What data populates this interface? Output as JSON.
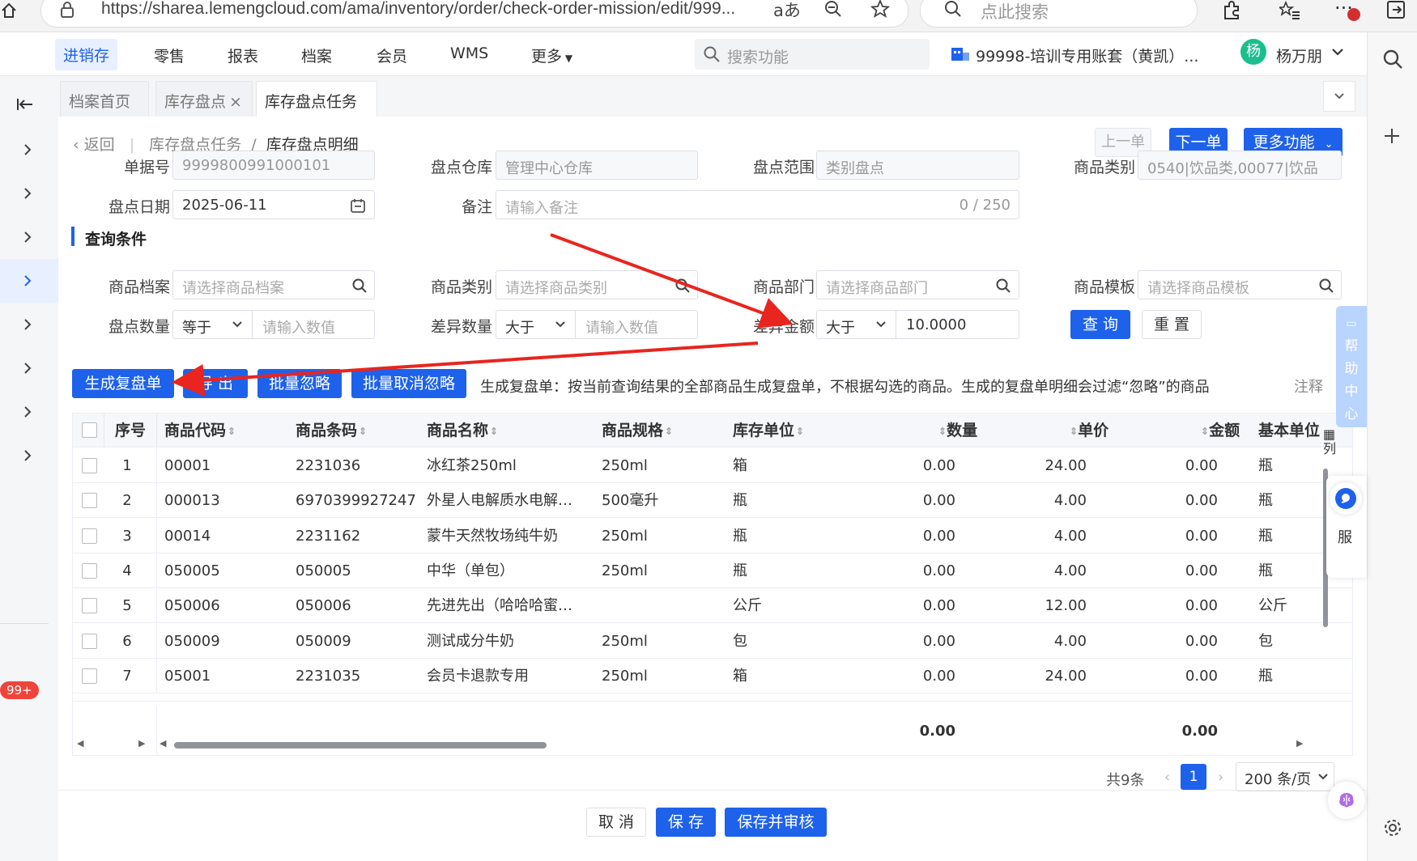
{
  "browser": {
    "url": "https://sharea.lemengcloud.com/ama/inventory/order/check-order-mission/edit/999...",
    "search_placeholder": "点此搜索",
    "reader_label": "aあ"
  },
  "nav": {
    "items": [
      "进销存",
      "零售",
      "报表",
      "档案",
      "会员",
      "WMS",
      "更多"
    ],
    "search_placeholder": "搜索功能",
    "account": "99998-培训专用账套（黄凯）...",
    "avatar_char": "杨",
    "user": "杨万朋"
  },
  "tabs": [
    {
      "label": "档案首页"
    },
    {
      "label": "库存盘点"
    },
    {
      "label": "库存盘点任务"
    }
  ],
  "breadcrumb": {
    "back": "返回",
    "parent": "库存盘点任务",
    "sep": "/",
    "current": "库存盘点明细"
  },
  "toolbar": {
    "prev": "上一单",
    "next": "下一单",
    "more": "更多功能"
  },
  "form": {
    "doc_no_label": "单据号",
    "doc_no": "9999800991000101",
    "warehouse_label": "盘点仓库",
    "warehouse": "管理中心仓库",
    "scope_label": "盘点范围",
    "scope": "类别盘点",
    "category_label": "商品类别",
    "category": "0540|饮品类,00077|饮品",
    "date_label": "盘点日期",
    "date": "2025-06-11",
    "remark_label": "备注",
    "remark_placeholder": "请输入备注",
    "remark_count": "0 / 250"
  },
  "query": {
    "section_title": "查询条件",
    "product_label": "商品档案",
    "product_ph": "请选择商品档案",
    "pcategory_label": "商品类别",
    "pcategory_ph": "请选择商品类别",
    "dept_label": "商品部门",
    "dept_ph": "请选择商品部门",
    "template_label": "商品模板",
    "template_ph": "请选择商品模板",
    "qty_label": "盘点数量",
    "qty_op": "等于",
    "qty_ph": "请输入数值",
    "diffqty_label": "差异数量",
    "diffqty_op": "大于",
    "diffqty_ph": "请输入数值",
    "diffamt_label": "差异金额",
    "diffamt_op": "大于",
    "diffamt_value": "10.0000",
    "search_btn": "查 询",
    "reset_btn": "重 置"
  },
  "actions": {
    "gen_recheck": "生成复盘单",
    "export": "导 出",
    "batch_ignore": "批量忽略",
    "batch_unignore": "批量取消忽略",
    "hint": "生成复盘单：按当前查询结果的全部商品生成复盘单，不根据勾选的商品。生成的复盘单明细会过滤“忽略”的商品",
    "note": "注释"
  },
  "table": {
    "headers": [
      "序号",
      "商品代码",
      "商品条码",
      "商品名称",
      "商品规格",
      "库存单位",
      "数量",
      "单价",
      "金额",
      "基本单位"
    ],
    "rows": [
      [
        "1",
        "00001",
        "2231036",
        "冰红茶250ml",
        "250ml",
        "箱",
        "0.00",
        "24.00",
        "0.00",
        "瓶"
      ],
      [
        "2",
        "000013",
        "6970399927247",
        "外星人电解质水电解…",
        "500毫升",
        "瓶",
        "0.00",
        "4.00",
        "0.00",
        "瓶"
      ],
      [
        "3",
        "00014",
        "2231162",
        "蒙牛天然牧场纯牛奶",
        "250ml",
        "瓶",
        "0.00",
        "4.00",
        "0.00",
        "瓶"
      ],
      [
        "4",
        "050005",
        "050005",
        "中华（单包）",
        "250ml",
        "瓶",
        "0.00",
        "4.00",
        "0.00",
        "瓶"
      ],
      [
        "5",
        "050006",
        "050006",
        "先进先出（哈哈哈蜜…",
        "",
        "公斤",
        "0.00",
        "12.00",
        "0.00",
        "公斤"
      ],
      [
        "6",
        "050009",
        "050009",
        "测试成分牛奶",
        "250ml",
        "包",
        "0.00",
        "4.00",
        "0.00",
        "包"
      ],
      [
        "7",
        "05001",
        "2231035",
        "会员卡退款专用",
        "250ml",
        "箱",
        "0.00",
        "24.00",
        "0.00",
        "瓶"
      ]
    ],
    "total_qty": "0.00",
    "total_amount": "0.00",
    "col_setting": "列"
  },
  "pagination": {
    "total": "共9条",
    "page": "1",
    "page_size": "200 条/页"
  },
  "footer": {
    "cancel": "取 消",
    "save": "保 存",
    "save_audit": "保存并审核"
  },
  "side": {
    "help": [
      "帮",
      "助",
      "中",
      "心"
    ],
    "service": "服",
    "badge": "99+"
  },
  "colors": {
    "primary": "#1e62ec",
    "annotation": "#e8251f"
  }
}
